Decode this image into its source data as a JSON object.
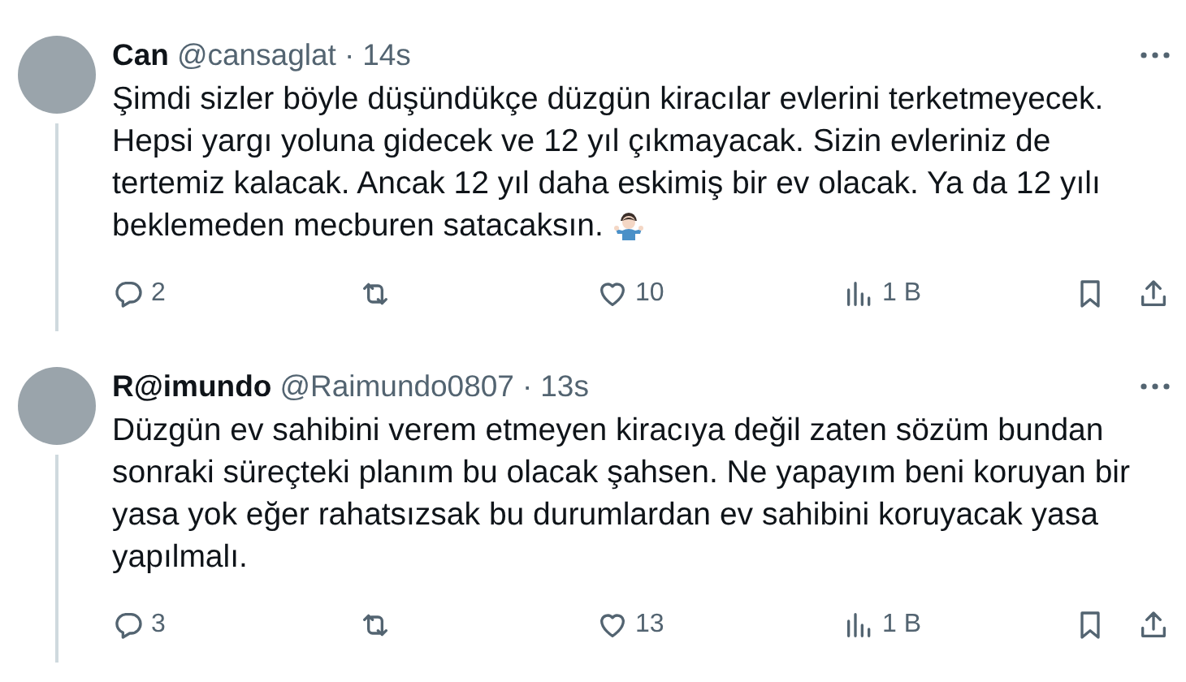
{
  "tweets": [
    {
      "name": "Can",
      "handle": "@cansaglat",
      "separator": "·",
      "time": "14s",
      "text": "Şimdi sizler böyle düşündükçe düzgün kiracılar evlerini terketmeyecek. Hepsi yargı yoluna gidecek ve 12 yıl çıkmayacak. Sizin evleriniz de tertemiz kalacak. Ancak 12 yıl daha eskimiş bir ev olacak. Ya da 12 yılı beklemeden mecburen satacaksın.",
      "shrug_emoji": true,
      "replies": "2",
      "likes": "10",
      "views": "1 B"
    },
    {
      "name": "R@imundo",
      "handle": "@Raimundo0807",
      "separator": "·",
      "time": "13s",
      "text": "Düzgün ev sahibini verem etmeyen kiracıya değil zaten sözüm bundan sonraki süreçteki planım bu olacak şahsen. Ne yapayım beni koruyan bir yasa yok eğer rahatsızsak bu durumlardan ev sahibini koruyacak yasa yapılmalı.",
      "shrug_emoji": false,
      "replies": "3",
      "likes": "13",
      "views": "1 B"
    }
  ]
}
